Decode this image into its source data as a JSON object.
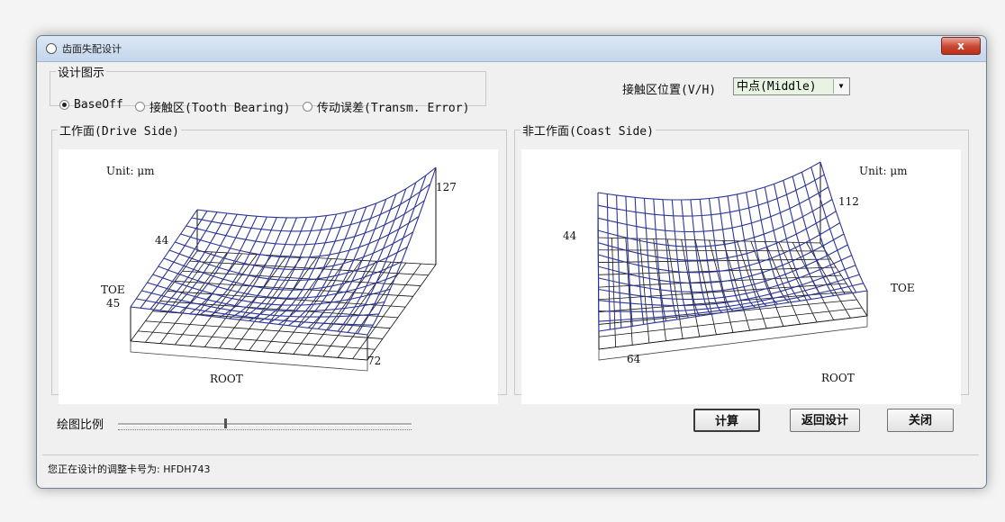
{
  "window": {
    "title": "齿面失配设计",
    "close_label": "x"
  },
  "design_group": {
    "legend": "设计图示",
    "options": [
      {
        "label": "BaseOff",
        "selected": true
      },
      {
        "label": "接触区(Tooth Bearing)",
        "selected": false
      },
      {
        "label": "传动误差(Transm. Error)",
        "selected": false
      }
    ]
  },
  "contact_position": {
    "label": "接触区位置(V/H)",
    "value": "中点(Middle)"
  },
  "drive_panel": {
    "legend": "工作面(Drive Side)",
    "unit": "Unit: μm",
    "labels": {
      "corner_back_right": "127",
      "corner_back_left": "44",
      "toe": "TOE",
      "corner_front_left": "45",
      "corner_front_right": "72",
      "root": "ROOT"
    }
  },
  "coast_panel": {
    "legend": "非工作面(Coast Side)",
    "unit": "Unit: μm",
    "labels": {
      "corner_back_right": "112",
      "corner_back_left": "44",
      "toe": "TOE",
      "corner_front_left": "64",
      "root": "ROOT"
    }
  },
  "scale": {
    "label": "绘图比例"
  },
  "buttons": {
    "calculate": "计算",
    "back": "返回设计",
    "close": "关闭"
  },
  "status": {
    "text": "您正在设计的调整卡号为: HFDH743"
  },
  "colors": {
    "mesh_blue": "#2b3596",
    "grid_black": "#111111",
    "plot_bg": "#ffffff"
  }
}
